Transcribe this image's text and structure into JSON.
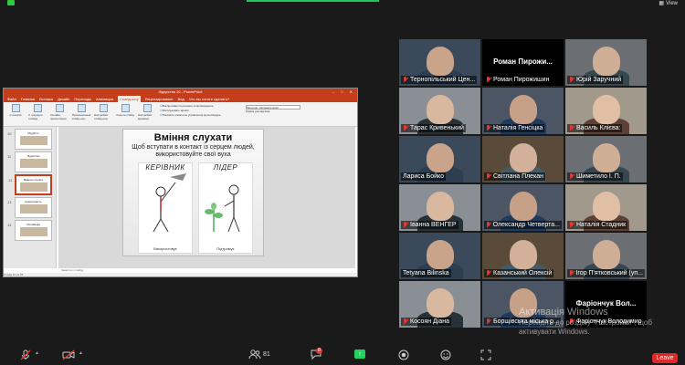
{
  "topbar": {
    "view_label": "View"
  },
  "powerpoint": {
    "title": "Лідерство 10 - PowerPoint",
    "tabs": [
      "Файл",
      "Главная",
      "Вставка",
      "Дизайн",
      "Переходы",
      "Анимация",
      "Слайд-шоу",
      "Рецензирование",
      "Вид",
      "Что вы хотите сделать?"
    ],
    "active_tab": "Слайд-шоу",
    "ribbon_groups": [
      "С начала",
      "С текущего слайда",
      "Онлайн-презентация",
      "Произвольный слайд-шоу",
      "Настройка слайд-шоу",
      "Скрыть слайд",
      "Настройка времени"
    ],
    "ribbon_checks": [
      "Воспроизвести речевое сопровождение",
      "Использовать время",
      "Показать элементы управления мультимедиа"
    ],
    "monitor_label": "Монитор: Автоматически",
    "presenter_label": "Режим докладчика",
    "thumb_numbers": [
      "10",
      "11",
      "12",
      "13",
      "14"
    ],
    "thumb_titles": [
      "Мудрість",
      "Лідерство",
      "Вміння слухати",
      "Креативність",
      "Мотивація"
    ],
    "slide": {
      "title": "Вміння слухати",
      "subtitle": "Щоб вступати в контакт із серцем людей, використовуйте свої вуха",
      "left_label": "КЕРІВНИК",
      "right_label": "ЛІДЕР",
      "left_caption": "Використовує",
      "right_caption": "Підтримує"
    },
    "notes_placeholder": "Заметки к слайду",
    "status": "Слайд 12 из 35"
  },
  "participants": [
    {
      "name": "Тернопільський Цен...",
      "muted": true,
      "kind": "video"
    },
    {
      "name": "Роман Пирожишин",
      "muted": true,
      "kind": "name",
      "center": "Роман Пирожи..."
    },
    {
      "name": "Юрій Заручний",
      "muted": true,
      "kind": "video"
    },
    {
      "name": "Тарас Кривенький",
      "muted": true,
      "kind": "video"
    },
    {
      "name": "Наталія Генсіцка",
      "muted": true,
      "kind": "video"
    },
    {
      "name": "Василь Клієва:",
      "muted": true,
      "kind": "video"
    },
    {
      "name": "Лариса Бойко",
      "muted": false,
      "kind": "video"
    },
    {
      "name": "Світлана Плекан",
      "muted": true,
      "kind": "video"
    },
    {
      "name": "Шиметило І. П.",
      "muted": true,
      "kind": "video"
    },
    {
      "name": "Іванна ВЕНГЕР",
      "muted": true,
      "kind": "video"
    },
    {
      "name": "Олександр Четверта...",
      "muted": true,
      "kind": "video"
    },
    {
      "name": "Наталія Стадник",
      "muted": true,
      "kind": "video"
    },
    {
      "name": "Tetyana Bilinska",
      "muted": false,
      "kind": "video",
      "active": true
    },
    {
      "name": "Казанський Олексій",
      "muted": true,
      "kind": "video"
    },
    {
      "name": "Ігор П'ятковський (уп...",
      "muted": true,
      "kind": "video"
    },
    {
      "name": "Косоян Діана",
      "muted": true,
      "kind": "video"
    },
    {
      "name": "Борщівська міська р...",
      "muted": true,
      "kind": "video"
    },
    {
      "name": "Фаріончук Володимир",
      "muted": true,
      "kind": "name",
      "center": "Фаріончук Вол..."
    }
  ],
  "watermark": {
    "line1": "Активація Windows",
    "line2": "Перейдіть до розділу \"Настройки\", щоб",
    "line3": "активувати Windows."
  },
  "toolbar": {
    "participants_count": "81",
    "chat_badge": "8",
    "leave_label": "Leave"
  },
  "colors": {
    "powerpoint_accent": "#c43e1c",
    "active_speaker": "#8bc34a",
    "leave": "#e02828",
    "share": "#23d160"
  }
}
